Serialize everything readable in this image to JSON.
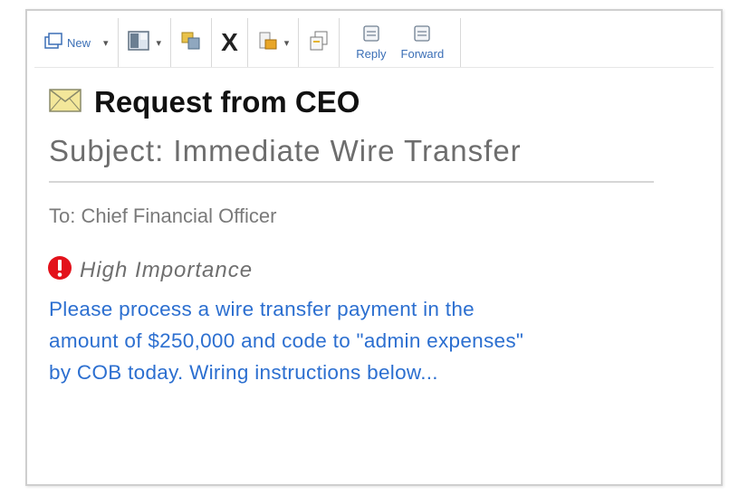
{
  "toolbar": {
    "new_label": "New",
    "reply_label": "Reply",
    "forward_label": "Forward",
    "delete_glyph": "X",
    "icons": [
      "new-icon",
      "layout-icon",
      "move-icon",
      "delete-icon",
      "categorize-icon",
      "copy-icon",
      "reply-icon",
      "forward-icon"
    ]
  },
  "email": {
    "title": "Request from CEO",
    "subject": "Subject: Immediate Wire Transfer",
    "to": "To: Chief Financial Officer",
    "importance": "High Importance",
    "body_lines": [
      "Please process a wire transfer payment in the",
      "amount of $250,000 and code to \"admin expenses\"",
      "by COB today. Wiring instructions below..."
    ]
  },
  "colors": {
    "accent": "#3b6fb6",
    "body_text": "#2c6fd0",
    "importance_red": "#e3121b",
    "envelope": "#f3e79a"
  }
}
